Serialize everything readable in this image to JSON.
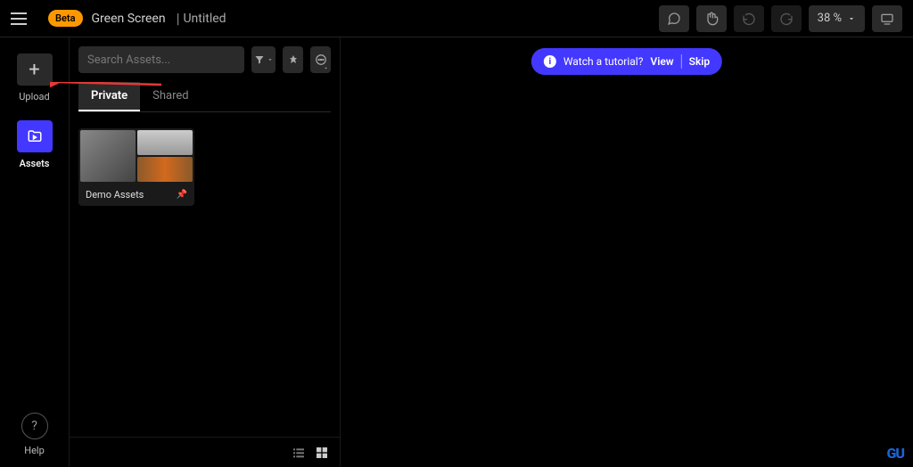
{
  "header": {
    "beta_label": "Beta",
    "app_name": "Green Screen",
    "project_title": "Untitled",
    "zoom": "38 %"
  },
  "leftnav": {
    "upload_label": "Upload",
    "assets_label": "Assets",
    "help_label": "Help"
  },
  "assets_panel": {
    "search_placeholder": "Search Assets...",
    "tabs": {
      "private": "Private",
      "shared": "Shared"
    },
    "folder": {
      "name": "Demo Assets"
    }
  },
  "tutorial": {
    "text": "Watch a tutorial?",
    "view": "View",
    "skip": "Skip"
  },
  "watermark": "GU",
  "colors": {
    "accent": "#4338ff",
    "beta": "#ff9800"
  }
}
